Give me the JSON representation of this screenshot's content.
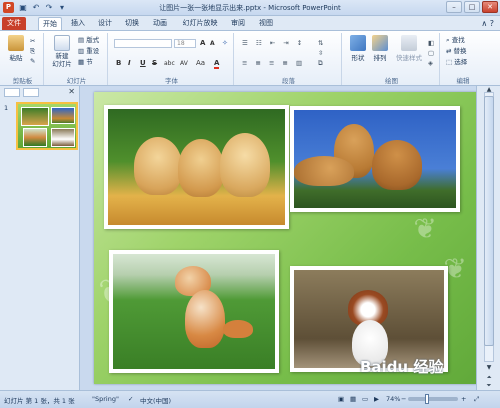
{
  "window": {
    "title": "让图片一张一张地显示出来.pptx - Microsoft PowerPoint",
    "app_icon": "P",
    "qat_icons": [
      "save-icon",
      "undo-icon",
      "redo-icon",
      "customize-icon"
    ],
    "controls": {
      "minimize": "–",
      "maximize": "□",
      "close": "✕"
    }
  },
  "tabs": [
    "文件",
    "开始",
    "插入",
    "设计",
    "切换",
    "动画",
    "幻灯片放映",
    "审阅",
    "视图"
  ],
  "active_tab": "开始",
  "tabs_right": "∧ ?",
  "ribbon": {
    "clipboard": {
      "paste": "粘贴",
      "label": "剪贴板"
    },
    "slides": {
      "new_slide": "新建\n幻灯片",
      "layout": "版式",
      "reset": "重设",
      "section": "节",
      "label": "幻灯片"
    },
    "font": {
      "font_name": "",
      "font_size": "18",
      "grow": "A",
      "shrink": "A",
      "bold": "B",
      "italic": "I",
      "underline": "U",
      "strike": "S",
      "shadow": "abc",
      "spacing": "AV",
      "case": "Aa",
      "color": "A",
      "label": "字体"
    },
    "paragraph": {
      "label": "段落"
    },
    "drawing": {
      "shapes": "形状",
      "arrange": "排列",
      "quick_styles": "快速样式",
      "label": "绘图"
    },
    "editing": {
      "find": "查找",
      "replace": "替换",
      "select": "选择",
      "label": "编辑"
    }
  },
  "left_panel": {
    "slide_number": "1",
    "close": "✕"
  },
  "statusbar": {
    "slide_info": "幻灯片 第 1 张，共 1 张",
    "theme": "\"Spring\"",
    "language": "中文(中国)",
    "zoom": "74%",
    "zoom_level": 0.74
  },
  "watermark": "Baidu 经验",
  "colors": {
    "file_tab": "#c8402a",
    "slide_green": "#77bd4a",
    "thumb_border": "#f6c042"
  }
}
